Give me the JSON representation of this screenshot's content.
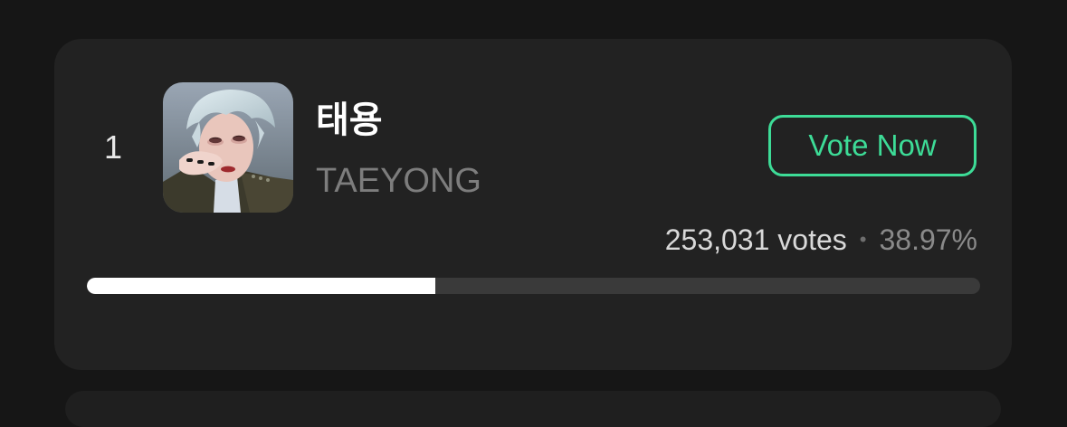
{
  "entry": {
    "rank": "1",
    "name_korean": "태용",
    "name_english": "TAEYONG",
    "vote_button_label": "Vote Now",
    "votes_text": "253,031 votes",
    "separator": "•",
    "percent_text": "38.97%",
    "progress_fraction": 0.3897
  },
  "colors": {
    "background": "#161616",
    "card": "#222222",
    "accent": "#3ddc97",
    "bar_fill": "#ffffff",
    "bar_track": "#3a3a3a"
  }
}
